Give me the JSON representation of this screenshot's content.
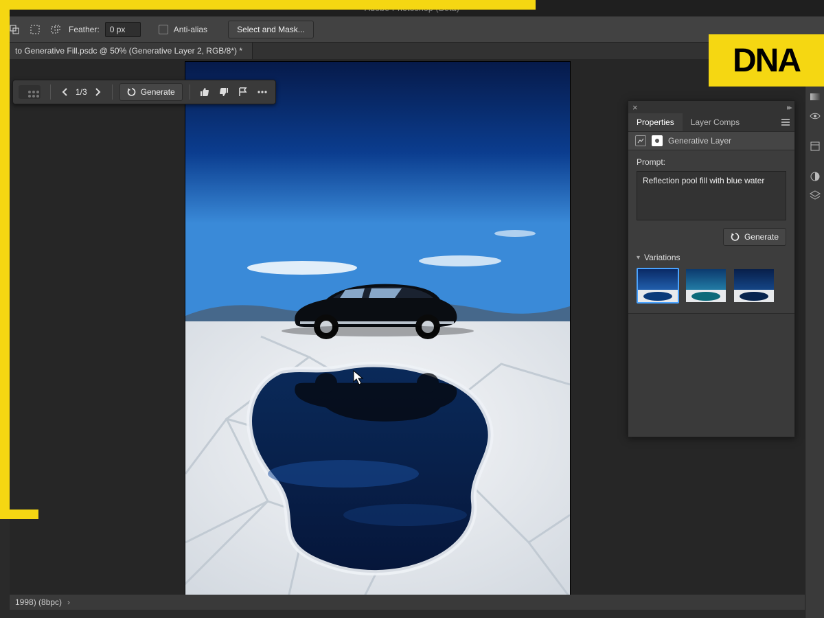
{
  "app": {
    "title": "Adobe Photoshop (Beta)"
  },
  "options": {
    "feather_label": "Feather:",
    "feather_value": "0 px",
    "antialias_label": "Anti-alias",
    "select_mask_label": "Select and Mask..."
  },
  "document": {
    "tab_title": "to Generative Fill.psdc @ 50% (Generative Layer 2, RGB/8*) *"
  },
  "floatbar": {
    "pager": "1/3",
    "generate_label": "Generate"
  },
  "panel": {
    "tabs": {
      "properties": "Properties",
      "layer_comps": "Layer Comps"
    },
    "layer_type": "Generative Layer",
    "prompt_label": "Prompt:",
    "prompt_value": "Reflection pool fill with blue water",
    "generate_label": "Generate",
    "variations_label": "Variations"
  },
  "status": {
    "left": "1998)  (8bpc)"
  },
  "branding": {
    "logo_text": "DNA"
  }
}
